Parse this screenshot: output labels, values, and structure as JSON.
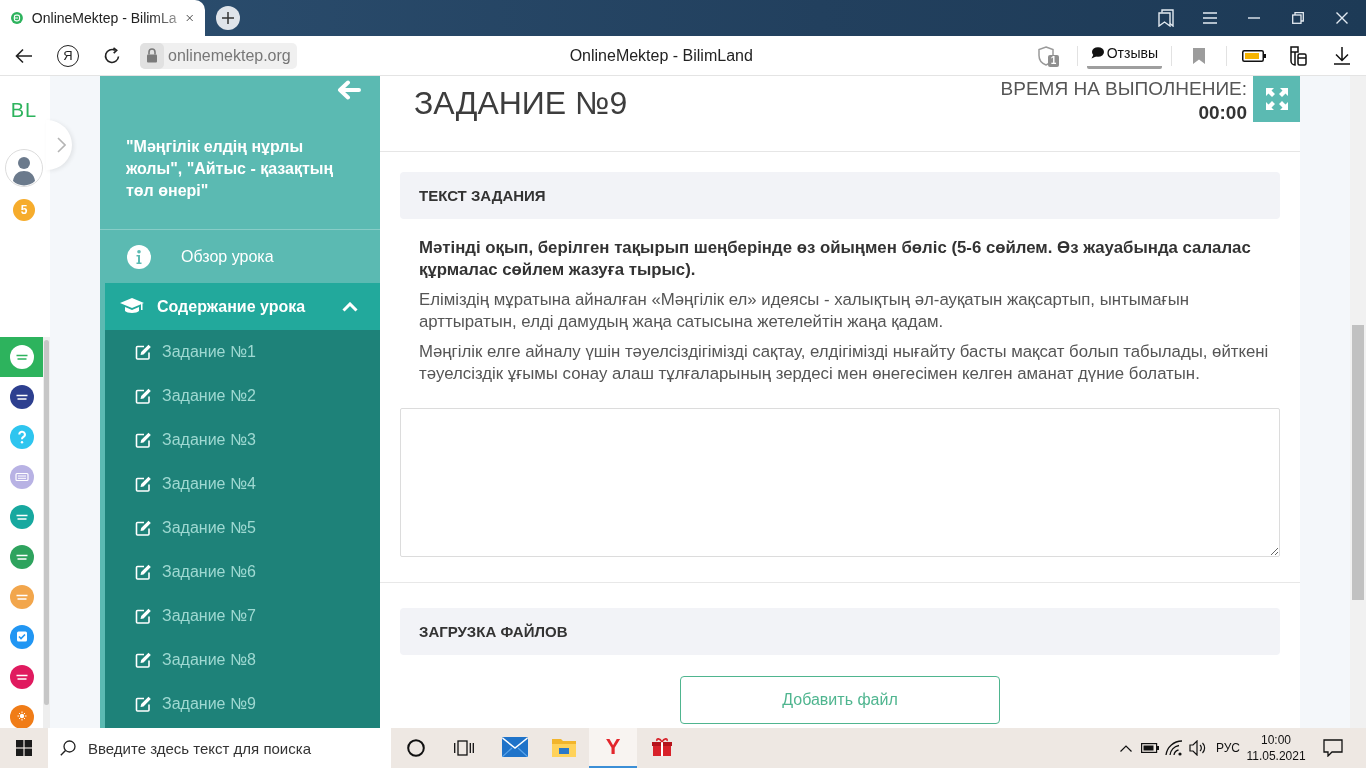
{
  "browser": {
    "tab_title": "OnlineMektep - BilimLa",
    "home_glyph": "Я",
    "address": "onlinemektep.org",
    "page_title": "OnlineMektep - BilimLand",
    "shield_badge": "1",
    "feedback": "Отзывы"
  },
  "rail": {
    "logo": "BL",
    "badge": "5",
    "apps": [
      {
        "kind": "wordmark",
        "color": "#ffffff",
        "selected": true
      },
      {
        "kind": "wordmark",
        "color": "#2d3f8f",
        "selected": false
      },
      {
        "kind": "question",
        "color": "#2ec5ef",
        "selected": false
      },
      {
        "kind": "keyboard",
        "color": "#b8b2e4",
        "selected": false
      },
      {
        "kind": "wordmark",
        "color": "#17a89f",
        "selected": false
      },
      {
        "kind": "wordmark",
        "color": "#2ea35e",
        "selected": false
      },
      {
        "kind": "wordmark",
        "color": "#f2a64c",
        "selected": false
      },
      {
        "kind": "check",
        "color": "#2196f3",
        "selected": false
      },
      {
        "kind": "wordmark",
        "color": "#e01a5f",
        "selected": false
      },
      {
        "kind": "sun",
        "color": "#f07c17",
        "selected": false
      }
    ]
  },
  "sidebar": {
    "title": "\"Мәңгілік елдің нұрлы жолы\", \"Айтыс - қазақтың төл өнері\"",
    "overview": "Обзор урока",
    "contents": {
      "label": "Содержание урока",
      "expanded": true,
      "items": [
        {
          "label": "Задание №1"
        },
        {
          "label": "Задание №2"
        },
        {
          "label": "Задание №3"
        },
        {
          "label": "Задание №4"
        },
        {
          "label": "Задание №5"
        },
        {
          "label": "Задание №6"
        },
        {
          "label": "Задание №7"
        },
        {
          "label": "Задание №8"
        },
        {
          "label": "Задание №9"
        }
      ]
    }
  },
  "task": {
    "title": "ЗАДАНИЕ №9",
    "timer_label": "ВРЕМЯ НА ВЫПОЛНЕНИЕ:",
    "timer_value": "00:00",
    "sections": [
      {
        "kind": "text",
        "heading": "ТЕКСТ ЗАДАНИЯ",
        "instruction": "Мәтінді оқып, берілген тақырып шеңберінде өз ойыңмен бөліс (5-6 сөйлем. Өз жауабында салалас құрмалас сөйлем жазуға тырыс).",
        "paragraphs": [
          "Еліміздің мұратына айналған «Мәңгілік ел» идеясы - халықтың әл-ауқатын жақсартып, ынтымағын арттыратын, елді дамудың жаңа сатысына жетелейтін жаңа қадам.",
          "Мәңгілік елге айналу үшін тәуелсіздігімізді сақтау, елдігімізді нығайту басты мақсат болып табылады, өйткені тәуелсіздік ұғымы сонау алаш тұлғаларының зердесі мен өнегесімен келген аманат дүние болатын."
        ]
      },
      {
        "kind": "upload",
        "heading": "ЗАГРУЗКА ФАЙЛОВ",
        "button": "Добавить файл"
      }
    ]
  },
  "taskbar": {
    "search": {
      "placeholder": "Введите здесь текст для поиска"
    },
    "apps": [
      {
        "kind": "mail",
        "selected": false
      },
      {
        "kind": "folder",
        "selected": false
      },
      {
        "kind": "browser",
        "glyph": "Y",
        "selected": true
      },
      {
        "kind": "gift",
        "selected": false
      }
    ],
    "language": "РУС",
    "time": "10:00",
    "date": "11.05.2021"
  }
}
